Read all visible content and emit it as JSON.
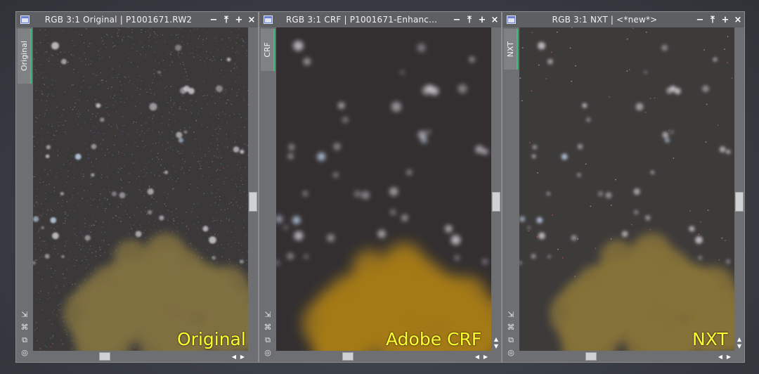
{
  "windows": [
    {
      "id": "original",
      "title": "RGB 3:1 Original | P1001671.RW2",
      "tab": "Original",
      "overlay_label": "Original",
      "image_style": "noisy"
    },
    {
      "id": "crf",
      "title": "RGB 3:1 CRF | P1001671-Enhanc...",
      "tab": "CRF",
      "overlay_label": "Adobe CRF",
      "image_style": "smooth"
    },
    {
      "id": "nxt",
      "title": "RGB 3:1 NXT | <*new*>",
      "tab": "NXT",
      "overlay_label": "NXT",
      "image_style": "denoised"
    }
  ],
  "controls": {
    "minimize": "−",
    "shade": "⤒",
    "maximize": "+",
    "close": "×"
  },
  "tools": [
    "⇲",
    "⌘",
    "⧉",
    "◎"
  ],
  "colors": {
    "label": "#ffff30",
    "tab_accent": "#3fc07a",
    "window_bg": "#6d6f72"
  }
}
